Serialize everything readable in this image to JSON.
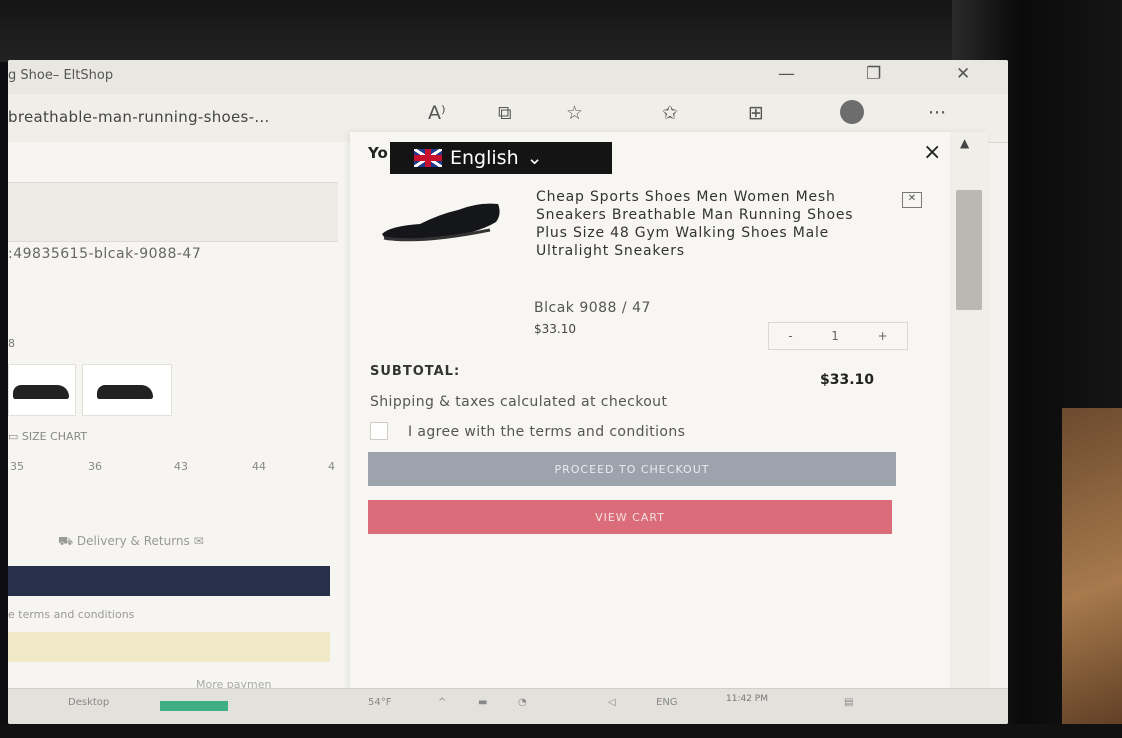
{
  "browser": {
    "tab_title": "g Shoe– EltShop",
    "url": "breathable-man-running-shoes-...",
    "toolbar_icons": [
      "read-aloud-icon",
      "split-screen-icon",
      "favorite-add-icon",
      "favorites-icon",
      "collections-icon",
      "profile-icon",
      "more-icon"
    ],
    "read_aloud_glyph": "A⁾",
    "more_glyph": "···"
  },
  "window_controls": {
    "minimize": "—",
    "restore": "❐",
    "close": "✕"
  },
  "left_page": {
    "sku": ":49835615-blcak-9088-47",
    "swatch_label": "8",
    "size_chart": "SIZE CHART",
    "sizes": [
      "35",
      "36",
      "43",
      "44",
      "4"
    ],
    "delivery": "Delivery & Returns",
    "terms": "e terms and conditions",
    "more_payment": "More paymen"
  },
  "cart": {
    "title": "Yo",
    "language": "English",
    "close": "×",
    "item": {
      "title": "Cheap Sports Shoes Men Women Mesh Sneakers Breathable Man Running Shoes Plus Size 48 Gym Walking Shoes Male Ultralight Sneakers",
      "variant": "Blcak 9088 / 47",
      "price": "$33.10",
      "quantity": "1",
      "minus": "-",
      "plus": "+",
      "remove": "✕"
    },
    "subtotal_label": "SUBTOTAL:",
    "subtotal_value": "$33.10",
    "shipping_note": "Shipping & taxes calculated at checkout",
    "agree_label": "I agree with the terms and conditions",
    "checkout_button": "PROCEED TO CHECKOUT",
    "view_cart_button": "VIEW CART"
  },
  "taskbar": {
    "desktop": "Desktop",
    "temp": "54°F",
    "lang": "ENG",
    "time": "11:42 PM"
  },
  "colors": {
    "checkout_disabled": "#9da3ac",
    "view_cart": "#db6c79",
    "navy_button": "#263149"
  }
}
